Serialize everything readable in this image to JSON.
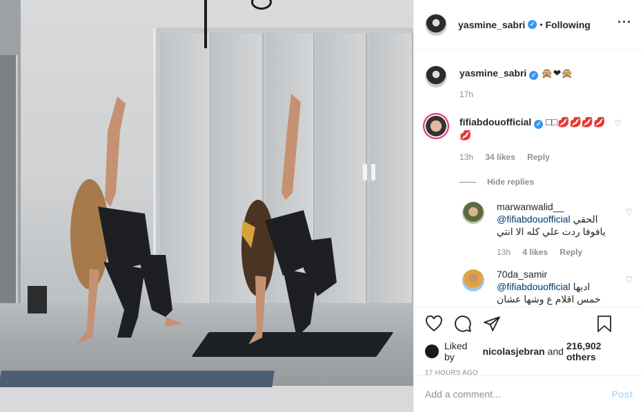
{
  "post": {
    "author": "yasmine_sabri",
    "follow_status": "Following",
    "more_icon": "more-options-icon",
    "caption": "🙊❤🙊",
    "caption_time": "17h"
  },
  "comments": [
    {
      "user": "fifiabdouofficial",
      "text": "□□💋💋💋💋 💋",
      "time": "13h",
      "likes": "34 likes",
      "reply_label": "Reply"
    }
  ],
  "hide_replies_label": "Hide replies",
  "replies": [
    {
      "user": "marwanwalid__",
      "mention": "@fifiabdouofficial",
      "text_a": "الحقي",
      "text_b": "يافوفا ردت علي كله الا انتي",
      "time": "13h",
      "likes": "4 likes",
      "reply_label": "Reply"
    },
    {
      "user": "70da_samir",
      "mention": "@fifiabdouofficial",
      "text_a": "اديها",
      "text_b": "خمس اقلام ع وشها عشان هي"
    }
  ],
  "likes": {
    "prefix": "Liked by",
    "user": "nicolasjebran",
    "mid": "and",
    "count": "216,902 others"
  },
  "time_ago": "17 HOURS AGO",
  "comment_box": {
    "placeholder": "Add a comment...",
    "post_label": "Post"
  },
  "colors": {
    "verified": "#3897f0",
    "post_button": "#b3dbff",
    "mention": "#00376b"
  }
}
